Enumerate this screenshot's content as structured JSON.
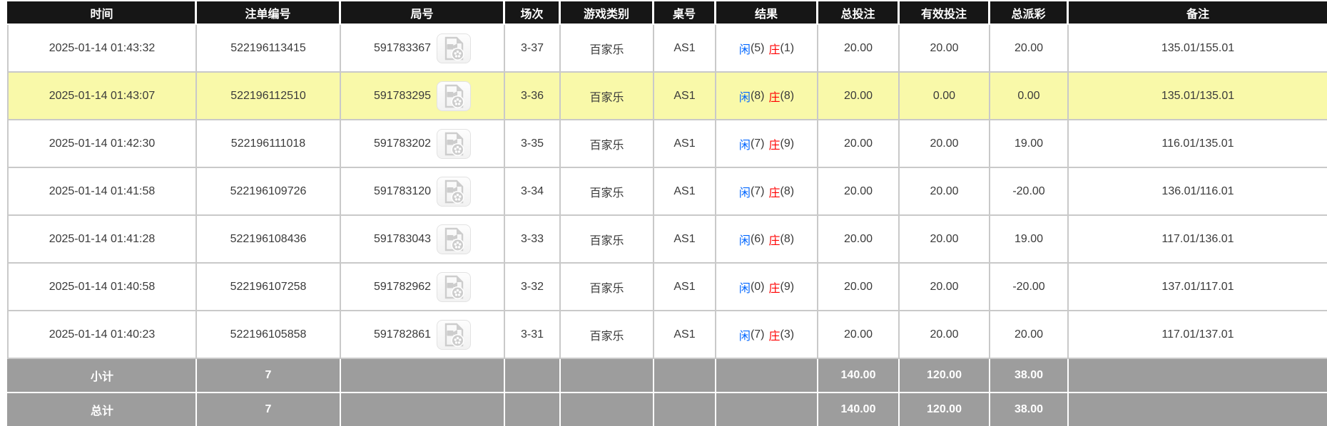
{
  "colors": {
    "accent_blue": "#0066ff",
    "loss_red": "#ff0000",
    "highlight_yellow": "#f9f9a9",
    "header_bg": "#161616",
    "summary_bg": "#9d9d9d",
    "grid_line": "#c9c9c9"
  },
  "table": {
    "columns": [
      {
        "key": "time",
        "label": "时间"
      },
      {
        "key": "bet_id",
        "label": "注单编号"
      },
      {
        "key": "round_id",
        "label": "局号"
      },
      {
        "key": "session",
        "label": "场次"
      },
      {
        "key": "game_type",
        "label": "游戏类别"
      },
      {
        "key": "table_no",
        "label": "桌号"
      },
      {
        "key": "result",
        "label": "结果"
      },
      {
        "key": "total_bet",
        "label": "总投注"
      },
      {
        "key": "valid_bet",
        "label": "有效投注"
      },
      {
        "key": "total_payout",
        "label": "总派彩"
      },
      {
        "key": "remark",
        "label": "备注"
      }
    ],
    "result_labels": {
      "player": "闲",
      "banker": "庄"
    },
    "icons": {
      "round_video": "video-replay-icon"
    },
    "rows": [
      {
        "time": "2025-01-14 01:43:32",
        "bet_id": "522196113415",
        "round_id": "591783367",
        "session": "3-37",
        "game_type": "百家乐",
        "table_no": "AS1",
        "player_points": "5",
        "banker_points": "1",
        "total_bet": "20.00",
        "valid_bet": "20.00",
        "total_payout": "20.00",
        "remark": "135.01/155.01",
        "highlighted": false
      },
      {
        "time": "2025-01-14 01:43:07",
        "bet_id": "522196112510",
        "round_id": "591783295",
        "session": "3-36",
        "game_type": "百家乐",
        "table_no": "AS1",
        "player_points": "8",
        "banker_points": "8",
        "total_bet": "20.00",
        "valid_bet": "0.00",
        "total_payout": "0.00",
        "remark": "135.01/135.01",
        "highlighted": true
      },
      {
        "time": "2025-01-14 01:42:30",
        "bet_id": "522196111018",
        "round_id": "591783202",
        "session": "3-35",
        "game_type": "百家乐",
        "table_no": "AS1",
        "player_points": "7",
        "banker_points": "9",
        "total_bet": "20.00",
        "valid_bet": "20.00",
        "total_payout": "19.00",
        "remark": "116.01/135.01",
        "highlighted": false
      },
      {
        "time": "2025-01-14 01:41:58",
        "bet_id": "522196109726",
        "round_id": "591783120",
        "session": "3-34",
        "game_type": "百家乐",
        "table_no": "AS1",
        "player_points": "7",
        "banker_points": "8",
        "total_bet": "20.00",
        "valid_bet": "20.00",
        "total_payout": "-20.00",
        "remark": "136.01/116.01",
        "highlighted": false
      },
      {
        "time": "2025-01-14 01:41:28",
        "bet_id": "522196108436",
        "round_id": "591783043",
        "session": "3-33",
        "game_type": "百家乐",
        "table_no": "AS1",
        "player_points": "6",
        "banker_points": "8",
        "total_bet": "20.00",
        "valid_bet": "20.00",
        "total_payout": "19.00",
        "remark": "117.01/136.01",
        "highlighted": false
      },
      {
        "time": "2025-01-14 01:40:58",
        "bet_id": "522196107258",
        "round_id": "591782962",
        "session": "3-32",
        "game_type": "百家乐",
        "table_no": "AS1",
        "player_points": "0",
        "banker_points": "9",
        "total_bet": "20.00",
        "valid_bet": "20.00",
        "total_payout": "-20.00",
        "remark": "137.01/117.01",
        "highlighted": false
      },
      {
        "time": "2025-01-14 01:40:23",
        "bet_id": "522196105858",
        "round_id": "591782861",
        "session": "3-31",
        "game_type": "百家乐",
        "table_no": "AS1",
        "player_points": "7",
        "banker_points": "3",
        "total_bet": "20.00",
        "valid_bet": "20.00",
        "total_payout": "20.00",
        "remark": "117.01/137.01",
        "highlighted": false
      }
    ],
    "summary_rows": [
      {
        "label": "小计",
        "count": "7",
        "total_bet": "140.00",
        "valid_bet": "120.00",
        "total_payout": "38.00",
        "remark": ""
      },
      {
        "label": "总计",
        "count": "7",
        "total_bet": "140.00",
        "valid_bet": "120.00",
        "total_payout": "38.00",
        "remark": ""
      }
    ]
  }
}
